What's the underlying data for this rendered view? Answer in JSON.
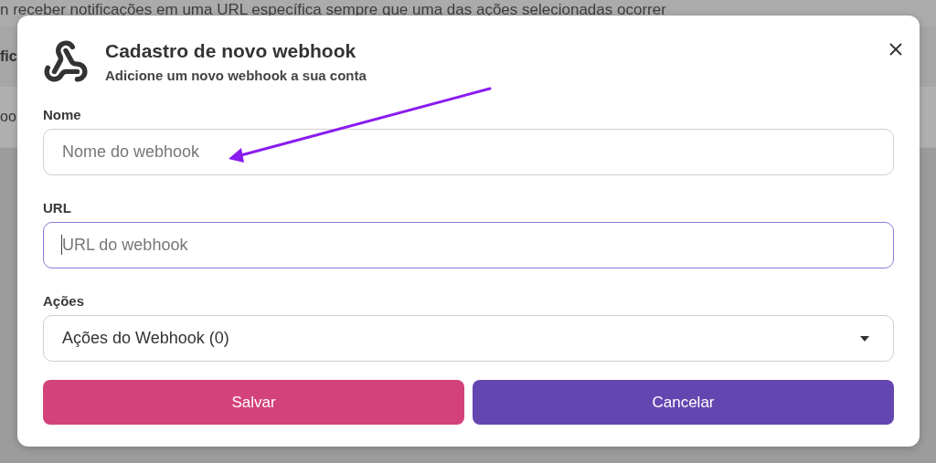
{
  "background": {
    "description": "n receber notificações em uma URL específica sempre que uma das ações selecionadas ocorrer",
    "fragments": [
      "fic",
      "oo"
    ]
  },
  "dialog": {
    "title": "Cadastro de novo webhook",
    "subtitle": "Adicione um novo webhook a sua conta",
    "fields": [
      {
        "kind": "text",
        "label": "Nome",
        "placeholder": "Nome do webhook",
        "focused": false
      },
      {
        "kind": "text",
        "label": "URL",
        "placeholder": "URL do webhook",
        "focused": true
      },
      {
        "kind": "select",
        "label": "Ações",
        "value": "Ações do Webhook (0)"
      }
    ],
    "buttons": [
      {
        "kind": "primary",
        "label": "Salvar"
      },
      {
        "kind": "secondary",
        "label": "Cancelar"
      }
    ]
  }
}
